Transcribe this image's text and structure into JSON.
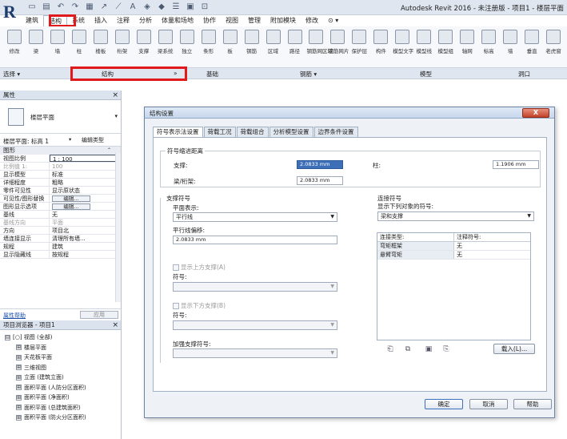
{
  "app": {
    "title": "Autodesk Revit 2016 - 未注册版 -   项目1 - 楼层平面"
  },
  "ribbon": {
    "tabs": [
      "建筑",
      "结构",
      "系统",
      "插入",
      "注释",
      "分析",
      "体量和场地",
      "协作",
      "视图",
      "管理",
      "附加模块",
      "修改",
      "⊙ ▾"
    ],
    "active_tab": "结构",
    "tools": [
      "修改",
      "梁",
      "墙",
      "柱",
      "楼板",
      "桁架",
      "支撑",
      "梁系统",
      "独立",
      "条形",
      "板",
      "钢筋",
      "区域",
      "路径",
      "钢筋网区域",
      "钢筋网片",
      "保护层",
      "构件",
      "模型文字",
      "模型线",
      "模型组",
      "轴网",
      "标高",
      "墙",
      "垂直",
      "老虎窗"
    ],
    "panels": {
      "select": "选择 ▾",
      "structure": "结构",
      "structure_arrow": "»",
      "foundation": "基础",
      "rebar": "钢筋 ▾",
      "model": "模型",
      "opening": "洞口"
    }
  },
  "properties": {
    "header": "属性",
    "close": "×",
    "type_name": "楼层平面",
    "type_arrow": "▾",
    "selector_label": "楼层平面: 标高 1",
    "selector_arrow": "▾",
    "edit_type_button": "编辑类型",
    "group_label": "图形",
    "group_collapse": "⌃",
    "rows": [
      {
        "key": "视图比例",
        "value": "1 : 100",
        "disabled": false,
        "boxed": true,
        "button": false
      },
      {
        "key": "比例值 1:",
        "value": "100",
        "disabled": true,
        "boxed": false,
        "button": false
      },
      {
        "key": "显示模型",
        "value": "标准",
        "disabled": false,
        "boxed": false,
        "button": false
      },
      {
        "key": "详细程度",
        "value": "粗略",
        "disabled": false,
        "boxed": false,
        "button": false
      },
      {
        "key": "零件可见性",
        "value": "显示原状态",
        "disabled": false,
        "boxed": false,
        "button": false
      },
      {
        "key": "可见性/图形替换",
        "value": "编辑...",
        "disabled": false,
        "boxed": false,
        "button": true
      },
      {
        "key": "图形显示选项",
        "value": "编辑...",
        "disabled": false,
        "boxed": false,
        "button": true
      },
      {
        "key": "基线",
        "value": "无",
        "disabled": false,
        "boxed": false,
        "button": false
      },
      {
        "key": "基线方向",
        "value": "平面",
        "disabled": true,
        "boxed": false,
        "button": false
      },
      {
        "key": "方向",
        "value": "项目北",
        "disabled": false,
        "boxed": false,
        "button": false
      },
      {
        "key": "墙连接显示",
        "value": "清理所有墙...",
        "disabled": false,
        "boxed": false,
        "button": false
      },
      {
        "key": "规程",
        "value": "建筑",
        "disabled": false,
        "boxed": false,
        "button": false
      },
      {
        "key": "显示隐藏线",
        "value": "按规程",
        "disabled": false,
        "boxed": false,
        "button": false
      }
    ],
    "help_link": "属性帮助",
    "apply_button": "应用"
  },
  "browser": {
    "header": "项目浏览器 - 项目1",
    "close": "×",
    "nodes": [
      {
        "toggle": "⊟",
        "label": "[○] 视图 (全部)",
        "indent": 0
      },
      {
        "toggle": "⊞",
        "label": "楼层平面",
        "indent": 1
      },
      {
        "toggle": "⊞",
        "label": "天花板平面",
        "indent": 1
      },
      {
        "toggle": "⊞",
        "label": "三维视图",
        "indent": 1
      },
      {
        "toggle": "⊞",
        "label": "立面 (建筑立面)",
        "indent": 1
      },
      {
        "toggle": "⊞",
        "label": "面积平面 (人防分区面积)",
        "indent": 1
      },
      {
        "toggle": "⊞",
        "label": "面积平面 (净面积)",
        "indent": 1
      },
      {
        "toggle": "⊞",
        "label": "面积平面 (总建筑面积)",
        "indent": 1
      },
      {
        "toggle": "⊞",
        "label": "面积平面 (防火分区面积)",
        "indent": 1
      }
    ]
  },
  "dialog": {
    "title": "结构设置",
    "close": "X",
    "tabs": [
      "符号表示法设置",
      "荷载工况",
      "荷载组合",
      "分析模型设置",
      "边界条件设置"
    ],
    "active_tab": 0,
    "cutback": {
      "legend": "符号缩进距离",
      "brace_label": "支撑:",
      "brace_value": "2.0833 mm",
      "beam_label": "梁/桁架:",
      "beam_value": "2.0833 mm",
      "column_label": "柱:",
      "column_value": "1.1906 mm"
    },
    "brace_symbols": {
      "legend": "支撑符号",
      "plan_label": "平面表示:",
      "plan_value": "平行线",
      "offset_label": "平行线偏移:",
      "offset_value": "2.0833 mm",
      "show_above_label": "显示上方支撑(A)",
      "symbol_above_label": "符号:",
      "show_below_label": "显示下方支撑(B)",
      "symbol_below_label": "符号:",
      "kicker_label": "加强支撑符号:"
    },
    "connection_symbols": {
      "legend": "连接符号",
      "show_label": "显示下列对象的符号:",
      "show_value": "梁和支撑",
      "col_type": "连接类型:",
      "col_symbol": "注释符号:",
      "rows": [
        {
          "type": "弯矩框架",
          "symbol": "无"
        },
        {
          "type": "悬臂弯矩",
          "symbol": "无"
        }
      ],
      "load_button": "载入(L)..."
    },
    "buttons": {
      "ok": "确定",
      "cancel": "取消",
      "help": "帮助"
    }
  },
  "colors": {
    "highlight": "#e0191c",
    "ribbon_bg": "#f6f8fb",
    "selection": "#3d6fb8"
  }
}
